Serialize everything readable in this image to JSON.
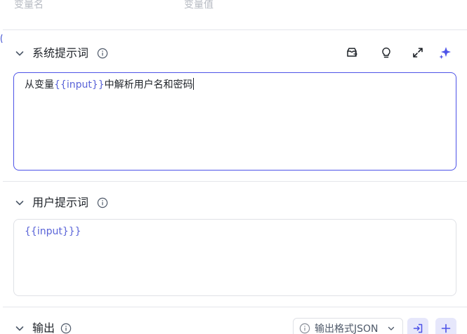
{
  "variables_header": {
    "name_col": "变量名",
    "value_col": "变量值"
  },
  "system_prompt": {
    "title": "系统提示词",
    "text_prefix": "从变量",
    "text_var": "{{input}}",
    "text_suffix": "中解析用户名和密码",
    "icons": [
      "library-icon",
      "lightbulb-icon",
      "expand-icon",
      "sparkle-icon"
    ]
  },
  "user_prompt": {
    "title": "用户提示词",
    "text_var": "{{input}}",
    "text_suffix": "}"
  },
  "output": {
    "title": "输出",
    "format_label": "输出格式JSON"
  },
  "colors": {
    "accent": "#4d53e8",
    "variable_text": "#5a64d8",
    "muted_text": "#b6bac2",
    "border": "#dfe1e6",
    "button_bg": "#e6e7fb"
  }
}
